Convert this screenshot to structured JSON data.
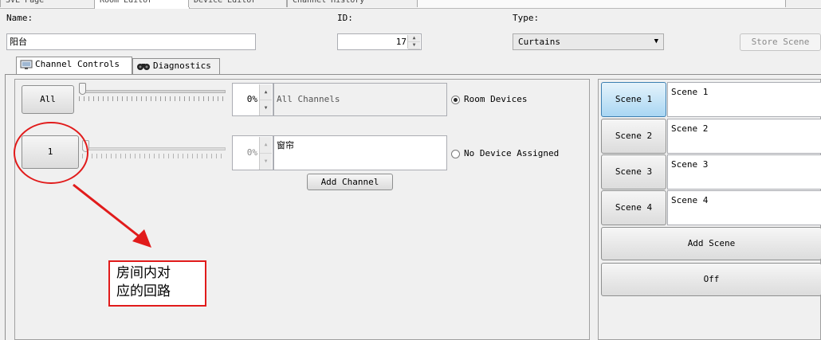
{
  "top_tabs": [
    "SVL Page",
    "Room Editor",
    "Device Editor",
    "Channel History"
  ],
  "header": {
    "name_label": "Name:",
    "name_value": "阳台",
    "id_label": "ID:",
    "id_value": "17",
    "type_label": "Type:",
    "type_value": "Curtains",
    "store_scene_label": "Store Scene"
  },
  "tabs": [
    "Channel Controls",
    "Diagnostics"
  ],
  "channels": [
    {
      "button": "All",
      "percent": "0%",
      "name": "All Channels",
      "radio_label": "Room Devices",
      "radio_checked": true,
      "level": 0
    },
    {
      "button": "1",
      "percent": "0%",
      "name": "窗帘",
      "radio_label": "No Device Assigned",
      "radio_checked": false,
      "level": 0
    }
  ],
  "add_channel_label": "Add Channel",
  "scenes": [
    {
      "button": "Scene 1",
      "name": "Scene 1",
      "selected": true
    },
    {
      "button": "Scene 2",
      "name": "Scene 2",
      "selected": false
    },
    {
      "button": "Scene 3",
      "name": "Scene 3",
      "selected": false
    },
    {
      "button": "Scene 4",
      "name": "Scene 4",
      "selected": false
    }
  ],
  "add_scene_label": "Add Scene",
  "off_label": "Off",
  "annotation": {
    "line1": "房间内对",
    "line2": "应的回路",
    "color": "#e11b1b"
  }
}
